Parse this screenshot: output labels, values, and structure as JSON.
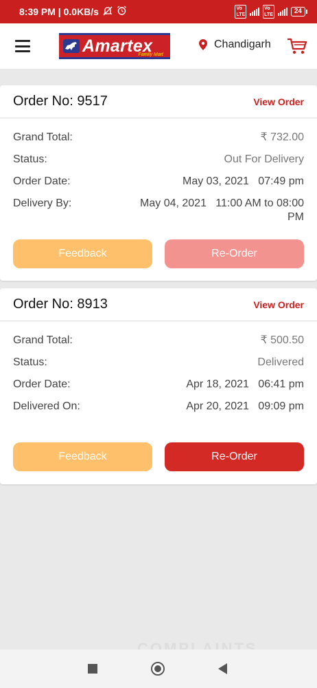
{
  "status_bar": {
    "time_speed": "8:39 PM | 0.0KB/s",
    "battery": "24"
  },
  "header": {
    "logo_text": "Amartex",
    "logo_sub": "Family Mart",
    "location": "Chandigarh"
  },
  "orders": [
    {
      "order_no": "Order No: 9517",
      "view_label": "View Order",
      "rows": [
        {
          "label": "Grand Total:",
          "value": "₹ 732.00"
        },
        {
          "label": "Status:",
          "value": "Out For Delivery"
        },
        {
          "label": "Order Date:",
          "value": "May 03, 2021   07:49 pm"
        },
        {
          "label": "Delivery By:",
          "value": "May 04, 2021   11:00 AM to 08:00 PM"
        }
      ],
      "feedback_label": "Feedback",
      "reorder_label": "Re-Order"
    },
    {
      "order_no": "Order No: 8913",
      "view_label": "View Order",
      "rows": [
        {
          "label": "Grand Total:",
          "value": "₹ 500.50"
        },
        {
          "label": "Status:",
          "value": "Delivered"
        },
        {
          "label": "Order Date:",
          "value": "Apr 18, 2021   06:41 pm"
        },
        {
          "label": "Delivered On:",
          "value": "Apr 20, 2021   09:09 pm"
        }
      ],
      "feedback_label": "Feedback",
      "reorder_label": "Re-Order"
    }
  ],
  "watermark": "COMPLAINTS",
  "colors": {
    "brand_red": "#c9201f",
    "feedback": "#fec06a",
    "reorder_disabled": "#f3938f",
    "reorder": "#d42a25"
  }
}
